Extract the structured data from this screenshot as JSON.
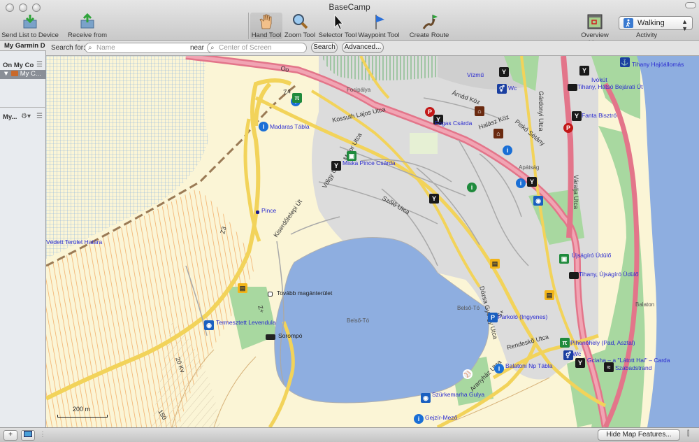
{
  "window": {
    "title": "BaseCamp"
  },
  "toolbar": {
    "send": "Send List to Device",
    "receive": "Receive from Device",
    "hand": "Hand Tool",
    "zoom": "Zoom Tool",
    "selector": "Selector Tool",
    "waypoint": "Waypoint Tool",
    "route": "Create Route",
    "overview": "Overview Map",
    "activity_label": "Activity",
    "activity_value": "Walking"
  },
  "search": {
    "label_for": "Search for:",
    "name_placeholder": "Name",
    "label_near": "near",
    "near_placeholder": "Center of Screen",
    "search_button": "Search",
    "advanced_button": "Advanced..."
  },
  "sidebar": {
    "tab": "My Garmin D",
    "on_my_computer": "On My Co",
    "my_collection": "My C...",
    "my_lists": "My..."
  },
  "map": {
    "scale": "200 m",
    "streets": [
      "Kossuth Lajos Utca",
      "Major Utca",
      "Völgy Utca",
      "Szőlő Utca",
      "Dózsa György Utca",
      "Kiserdőtelepi Út",
      "Rendeskő Utca",
      "Aranyház Utca",
      "Váralja Utca",
      "Gárdonyi Utca",
      "Árnád Köz",
      "Halász Köz",
      "Piskó Sétány",
      "Z3",
      "Z4",
      "Z+",
      "S+",
      "20 Kv",
      "150",
      "Oo"
    ],
    "places": [
      "Focipálya",
      "Belső-Tó",
      "Belső-Tó",
      "Balaton",
      "Apátság",
      "Vízmű"
    ],
    "poi": [
      {
        "label": "Madaras Tábla",
        "color": "#1a6fd6",
        "glyph": "i"
      },
      {
        "label": "Miska Pince Csárda",
        "color": "#1f8a3c",
        "glyph": "■"
      },
      {
        "label": "Pince",
        "color": "#1a1a8c",
        "glyph": "■"
      },
      {
        "label": "Védett Terület Határa",
        "color": "",
        "glyph": ""
      },
      {
        "label": "Tovább magánterület",
        "color": "#ffffff",
        "glyph": "□"
      },
      {
        "label": "Termesztett Levendula",
        "color": "#1a5fc0",
        "glyph": "◉"
      },
      {
        "label": "Sorompó",
        "color": "#222",
        "glyph": "▬"
      },
      {
        "label": "Fogas Csárda",
        "color": "#1a1a1a",
        "glyph": "Y"
      },
      {
        "label": "Tihany Hajóállomás",
        "color": "#1a3fa0",
        "glyph": "⚓"
      },
      {
        "label": "Ivókút",
        "color": "#1a1a1a",
        "glyph": "Y"
      },
      {
        "label": "Tihany, Hátsó Bejárati Út",
        "color": "#1a1a1a",
        "glyph": "▬"
      },
      {
        "label": "Fanta Bisztró",
        "color": "#1a1a1a",
        "glyph": "Y"
      },
      {
        "label": "Wc",
        "color": "#1a3fa0",
        "glyph": "⚥"
      },
      {
        "label": "Újságíró Üdülő",
        "color": "#1f8a3c",
        "glyph": "■"
      },
      {
        "label": "Tihany, Újságíró Üdülő",
        "color": "#1a1a1a",
        "glyph": "▬"
      },
      {
        "label": "Parkoló (Ingyenes)",
        "color": "#1a5fc0",
        "glyph": "P"
      },
      {
        "label": "Pihenőhely (Pad, Asztal)",
        "color": "#1f8a3c",
        "glyph": "π"
      },
      {
        "label": "Wc",
        "color": "#1a3fa0",
        "glyph": "⚥"
      },
      {
        "label": "Gciaha – a \"Látott Hal\" – Carda",
        "color": "#1a1a1a",
        "glyph": "Y"
      },
      {
        "label": "Szabadstrand",
        "color": "#1a1a1a",
        "glyph": "≈"
      },
      {
        "label": "Balatoni Np Tábla",
        "color": "#1a6fd6",
        "glyph": "i"
      },
      {
        "label": "Szürkemarha Gulya",
        "color": "#1a5fc0",
        "glyph": "◉"
      },
      {
        "label": "Gejzír-Mező",
        "color": "#1a6fd6",
        "glyph": "i"
      }
    ]
  },
  "bottom": {
    "hide_features": "Hide Map Features...",
    "add": "+"
  }
}
